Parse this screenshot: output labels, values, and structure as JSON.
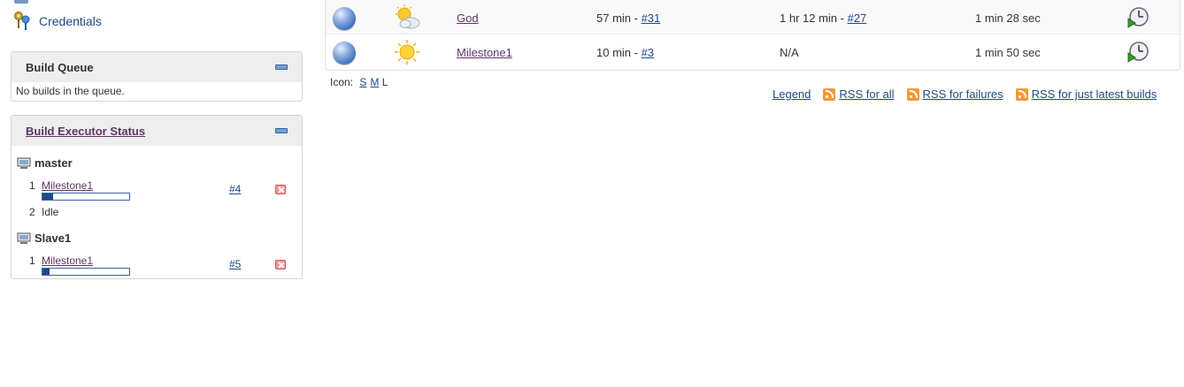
{
  "sidebar": {
    "credentials_label": "Credentials",
    "build_queue": {
      "title": "Build Queue",
      "empty_text": "No builds in the queue."
    },
    "executors": {
      "title": "Build Executor Status",
      "nodes": [
        {
          "name": "master",
          "rows": [
            {
              "num": "1",
              "job": "Milestone1",
              "progress": 0.12,
              "build": "#4"
            },
            {
              "num": "2",
              "idle": "Idle"
            }
          ]
        },
        {
          "name": "Slave1",
          "rows": [
            {
              "num": "1",
              "job": "Milestone1",
              "progress": 0.08,
              "build": "#5"
            }
          ]
        }
      ]
    }
  },
  "jobs": [
    {
      "name": "God",
      "weather": "partly-cloudy-icon",
      "last_success": "57 min - ",
      "last_success_link": "#31",
      "last_failure": "1 hr 12 min - ",
      "last_failure_link": "#27",
      "last_duration": "1 min 28 sec"
    },
    {
      "name": "Milestone1",
      "weather": "sunny-icon",
      "last_success": "10 min - ",
      "last_success_link": "#3",
      "last_failure": "N/A",
      "last_failure_link": "",
      "last_duration": "1 min 50 sec"
    }
  ],
  "icon_size": {
    "label": "Icon:",
    "s": "S",
    "m": "M",
    "l": "L"
  },
  "footer_links": {
    "legend": "Legend",
    "rss_all": "RSS for all",
    "rss_failures": "RSS for failures",
    "rss_latest": "RSS for just latest builds"
  },
  "colors": {
    "link": "#204a87",
    "progress": "#204a87",
    "header_bg": "#eeeeee"
  }
}
